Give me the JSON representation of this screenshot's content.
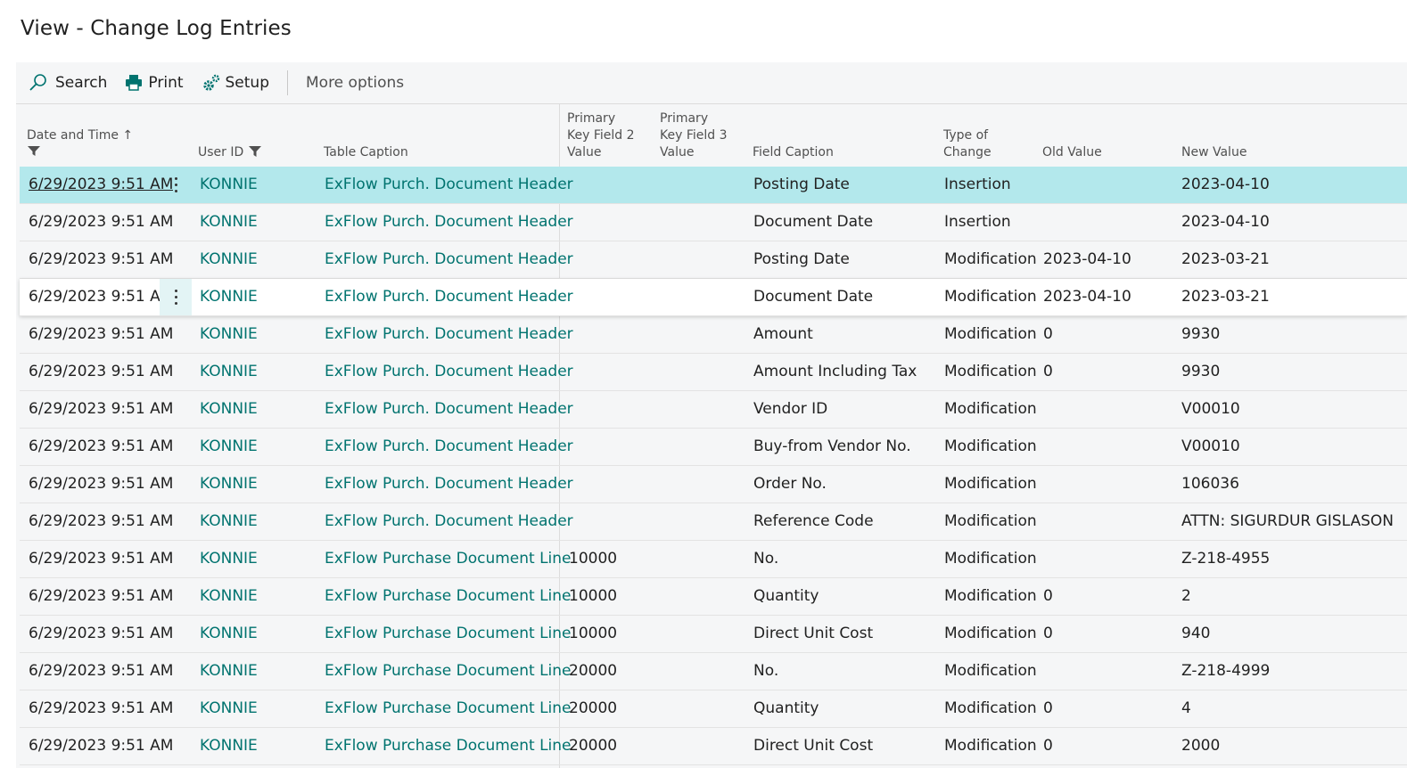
{
  "page": {
    "title": "View - Change Log Entries"
  },
  "toolbar": {
    "search_label": "Search",
    "print_label": "Print",
    "setup_label": "Setup",
    "more_label": "More options"
  },
  "columns": {
    "datetime": "Date and Time",
    "sort_indicator": "↑",
    "user_id": "User ID",
    "table_caption": "Table Caption",
    "pk2": [
      "Primary",
      "Key Field 2",
      "Value"
    ],
    "pk3": [
      "Primary",
      "Key Field 3",
      "Value"
    ],
    "field_caption": "Field Caption",
    "type_of_change": [
      "Type of",
      "Change"
    ],
    "old_value": "Old Value",
    "new_value": "New Value"
  },
  "colors": {
    "link": "#00736f",
    "selected_row": "#b3e8ec"
  },
  "rows": [
    {
      "datetime": "6/29/2023 9:51 AM",
      "user": "KONNIE",
      "table": "ExFlow Purch. Document Header",
      "pk2": "",
      "pk3": "",
      "field": "Posting Date",
      "type": "Insertion",
      "old": "",
      "new": "2023-04-10"
    },
    {
      "datetime": "6/29/2023 9:51 AM",
      "user": "KONNIE",
      "table": "ExFlow Purch. Document Header",
      "pk2": "",
      "pk3": "",
      "field": "Document Date",
      "type": "Insertion",
      "old": "",
      "new": "2023-04-10"
    },
    {
      "datetime": "6/29/2023 9:51 AM",
      "user": "KONNIE",
      "table": "ExFlow Purch. Document Header",
      "pk2": "",
      "pk3": "",
      "field": "Posting Date",
      "type": "Modification",
      "old": "2023-04-10",
      "new": "2023-03-21"
    },
    {
      "datetime": "6/29/2023 9:51 AM",
      "user": "KONNIE",
      "table": "ExFlow Purch. Document Header",
      "pk2": "",
      "pk3": "",
      "field": "Document Date",
      "type": "Modification",
      "old": "2023-04-10",
      "new": "2023-03-21"
    },
    {
      "datetime": "6/29/2023 9:51 AM",
      "user": "KONNIE",
      "table": "ExFlow Purch. Document Header",
      "pk2": "",
      "pk3": "",
      "field": "Amount",
      "type": "Modification",
      "old": "0",
      "new": "9930"
    },
    {
      "datetime": "6/29/2023 9:51 AM",
      "user": "KONNIE",
      "table": "ExFlow Purch. Document Header",
      "pk2": "",
      "pk3": "",
      "field": "Amount Including Tax",
      "type": "Modification",
      "old": "0",
      "new": "9930"
    },
    {
      "datetime": "6/29/2023 9:51 AM",
      "user": "KONNIE",
      "table": "ExFlow Purch. Document Header",
      "pk2": "",
      "pk3": "",
      "field": "Vendor ID",
      "type": "Modification",
      "old": "",
      "new": "V00010"
    },
    {
      "datetime": "6/29/2023 9:51 AM",
      "user": "KONNIE",
      "table": "ExFlow Purch. Document Header",
      "pk2": "",
      "pk3": "",
      "field": "Buy-from Vendor No.",
      "type": "Modification",
      "old": "",
      "new": "V00010"
    },
    {
      "datetime": "6/29/2023 9:51 AM",
      "user": "KONNIE",
      "table": "ExFlow Purch. Document Header",
      "pk2": "",
      "pk3": "",
      "field": "Order No.",
      "type": "Modification",
      "old": "",
      "new": "106036"
    },
    {
      "datetime": "6/29/2023 9:51 AM",
      "user": "KONNIE",
      "table": "ExFlow Purch. Document Header",
      "pk2": "",
      "pk3": "",
      "field": "Reference Code",
      "type": "Modification",
      "old": "",
      "new": "ATTN: SIGURDUR GISLASON"
    },
    {
      "datetime": "6/29/2023 9:51 AM",
      "user": "KONNIE",
      "table": "ExFlow Purchase Document Line",
      "pk2": "10000",
      "pk3": "",
      "field": "No.",
      "type": "Modification",
      "old": "",
      "new": "Z-218-4955"
    },
    {
      "datetime": "6/29/2023 9:51 AM",
      "user": "KONNIE",
      "table": "ExFlow Purchase Document Line",
      "pk2": "10000",
      "pk3": "",
      "field": "Quantity",
      "type": "Modification",
      "old": "0",
      "new": "2"
    },
    {
      "datetime": "6/29/2023 9:51 AM",
      "user": "KONNIE",
      "table": "ExFlow Purchase Document Line",
      "pk2": "10000",
      "pk3": "",
      "field": "Direct Unit Cost",
      "type": "Modification",
      "old": "0",
      "new": "940"
    },
    {
      "datetime": "6/29/2023 9:51 AM",
      "user": "KONNIE",
      "table": "ExFlow Purchase Document Line",
      "pk2": "20000",
      "pk3": "",
      "field": "No.",
      "type": "Modification",
      "old": "",
      "new": "Z-218-4999"
    },
    {
      "datetime": "6/29/2023 9:51 AM",
      "user": "KONNIE",
      "table": "ExFlow Purchase Document Line",
      "pk2": "20000",
      "pk3": "",
      "field": "Quantity",
      "type": "Modification",
      "old": "0",
      "new": "4"
    },
    {
      "datetime": "6/29/2023 9:51 AM",
      "user": "KONNIE",
      "table": "ExFlow Purchase Document Line",
      "pk2": "20000",
      "pk3": "",
      "field": "Direct Unit Cost",
      "type": "Modification",
      "old": "0",
      "new": "2000"
    }
  ]
}
